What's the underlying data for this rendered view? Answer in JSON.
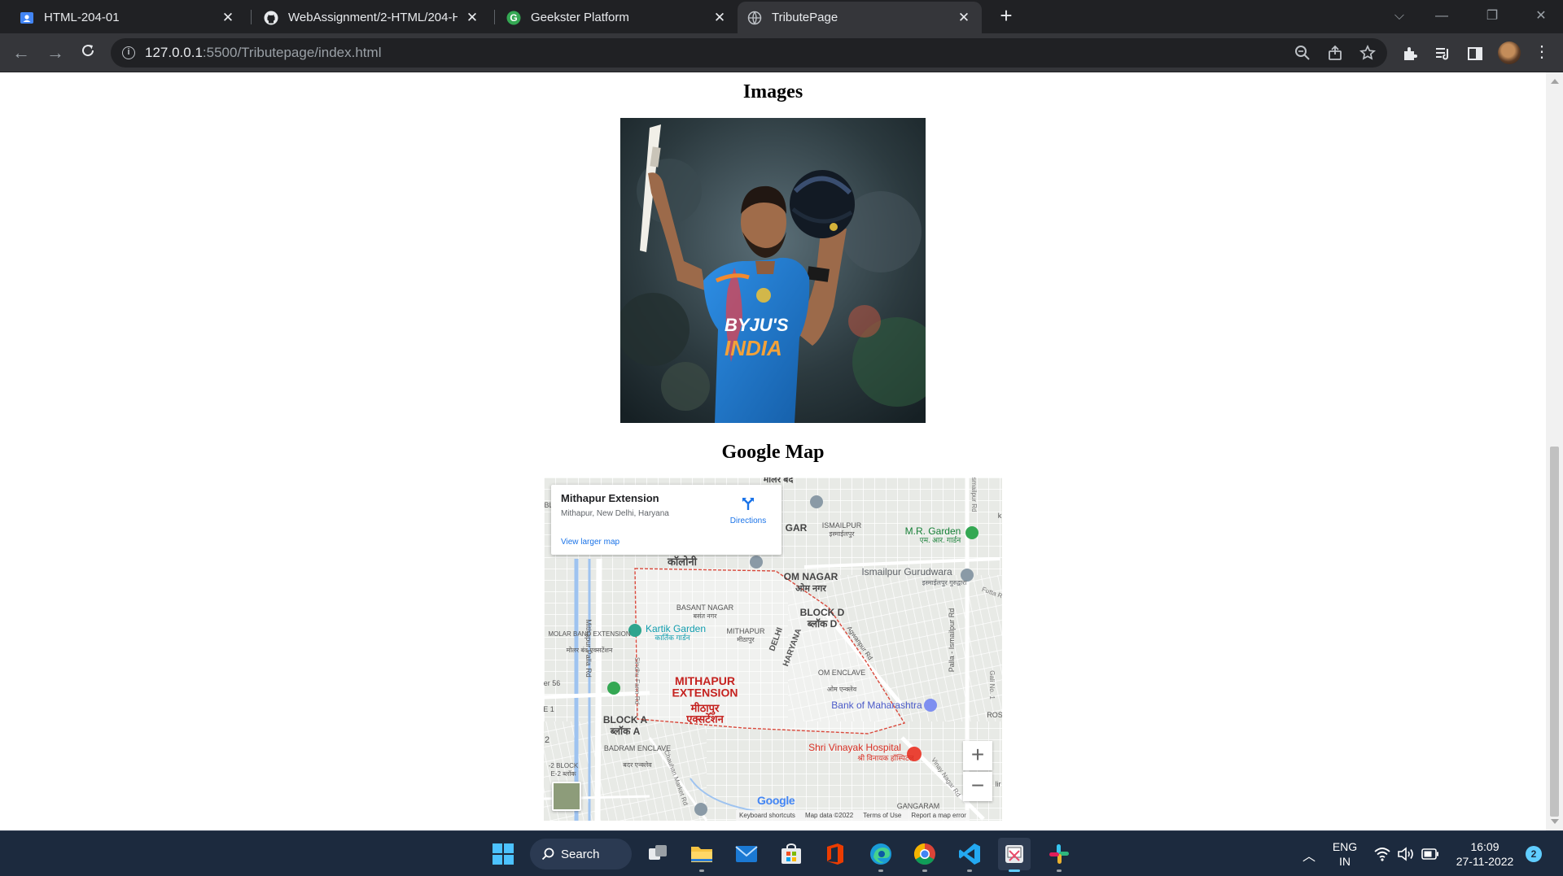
{
  "browser": {
    "tabs": [
      {
        "title": "HTML-204-01",
        "icon": "classroom-icon"
      },
      {
        "title": "WebAssignment/2-HTML/204-HTML",
        "icon": "github-icon"
      },
      {
        "title": "Geekster Platform",
        "icon": "geekster-icon"
      },
      {
        "title": "TributePage",
        "icon": "globe-icon"
      }
    ],
    "url_host": "127.0.0.1",
    "url_rest": ":5500/Tributepage/index.html"
  },
  "page": {
    "images_heading": "Images",
    "map_heading": "Google Map",
    "photo": {
      "jersey_brand": "BYJU'S",
      "jersey_country": "INDIA"
    }
  },
  "map": {
    "place_name": "Mithapur Extension",
    "place_address": "Mithapur, New Delhi, Haryana",
    "directions_label": "Directions",
    "larger_map_label": "View larger map",
    "zoom_in": "+",
    "zoom_out": "−",
    "google_logo": "Google",
    "attribution": {
      "shortcuts": "Keyboard shortcuts",
      "data": "Map data ©2022",
      "terms": "Terms of Use",
      "report": "Report a map error"
    },
    "labels": {
      "area_main_en": "MITHAPUR\nEXTENSION",
      "area_main_hi": "मीठापुर\nएक्सटेंशन",
      "basant_nagar": "BASANT NAGAR",
      "basant_nagar_hi": "बसंत नगर",
      "mithapur": "MITHAPUR",
      "mithapur_hi": "मीठापुर",
      "om_nagar": "OM NAGAR",
      "om_nagar_hi": "ओम नगर",
      "block_d": "BLOCK D",
      "block_d_hi": "ब्लॉक D",
      "block_a": "BLOCK A",
      "block_a_hi": "ब्लॉक A",
      "om_enclave": "OM ENCLAVE",
      "om_enclave_hi": "ओम एन्क्लेव",
      "badrapur_enclave": "BADRAM ENCLAVE",
      "badrapur_enclave_hi": "बदर एन्क्लेव",
      "molar_band": "MOLAR BAND EXTENSION",
      "molar_band_hi": "मोलर बंद एक्सटेंशन",
      "ismailpur": "ISMAILPUR",
      "ismailpur_hi": "इस्माईलपुर",
      "gar": "GAR",
      "colony_hi": "कॉलोनी",
      "molar_band_top": "मोलर बंद",
      "kartik_garden": "Kartik Garden",
      "kartik_garden_hi": "कार्तिक गार्डन",
      "mr_garden": "M.R. Garden",
      "mr_garden_hi": "एम. आर. गार्डन",
      "gurudwara": "Ismailpur Gurudwara",
      "gurudwara_hi": "इस्माईलपुर गुरुद्वारा",
      "bank": "Bank of Maharashtra",
      "hospital": "Shri Vinayak Hospital",
      "hospital_hi": "श्री विनायक हॉस्पिटल",
      "delhi": "DELHI",
      "haryana": "HARYANA",
      "gangaram": "GANGARAM",
      "block_e2": "-2 BLOCK",
      "block_e2_hi": "E-2 ब्लॉक",
      "road_mithapur": "Mithapur Palla Rd",
      "road_palla": "Palla - Ismailpur Rd",
      "road_agwanpur": "Agwanpur Rd",
      "road_sindhu": "Sindhu Farm Rd",
      "road_chauhan": "Chauhan Market Rd",
      "road_vinay": "Vinay Nagar Rd",
      "road_futta": "Futta R",
      "road_ismail": "Ismailpur Rd",
      "road_gali": "Gali No. 1",
      "sector56": "er 56",
      "e1": "E 1",
      "num2": "2",
      "bl": "BL",
      "k": "k",
      "ros": "ROS",
      "lir": "lir"
    }
  },
  "taskbar": {
    "search_label": "Search",
    "lang_line1": "ENG",
    "lang_line2": "IN",
    "time": "16:09",
    "date": "27-11-2022",
    "notifications": "2",
    "apps": [
      "windows-start",
      "search",
      "task-view",
      "file-explorer",
      "mail",
      "microsoft-store",
      "office",
      "edge",
      "chrome",
      "vscode",
      "snipping-tool",
      "slack"
    ]
  }
}
